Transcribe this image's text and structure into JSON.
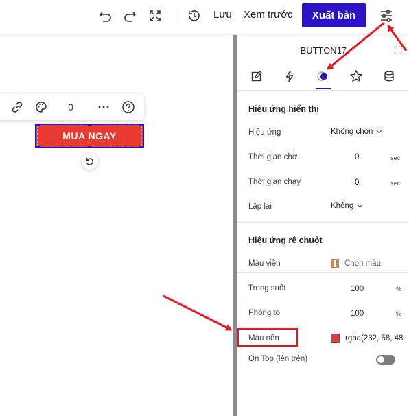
{
  "toolbar": {
    "undo_icon": "undo-icon",
    "redo_icon": "redo-icon",
    "fullscreen_icon": "fullscreen-icon",
    "history_icon": "history-icon",
    "save_label": "Lưu",
    "preview_label": "Xem trước",
    "publish_label": "Xuất bản",
    "settings_icon": "sliders-icon"
  },
  "canvas": {
    "floating_toolbar": {
      "link_icon": "link-icon",
      "palette_icon": "palette-icon",
      "count": "0",
      "more_icon": "more-icon",
      "help_icon": "help-icon"
    },
    "button_text": "MUA NGAY",
    "button_color": "#e83a30",
    "rotate_icon": "rotate-icon"
  },
  "panel": {
    "element_name": "BUTTON17",
    "tabs": [
      {
        "icon": "edit-icon"
      },
      {
        "icon": "lightning-icon"
      },
      {
        "icon": "effects-icon",
        "active": true
      },
      {
        "icon": "star-icon"
      },
      {
        "icon": "database-icon"
      }
    ],
    "display_effect": {
      "title": "Hiệu ứng hiển thị",
      "effect_label": "Hiệu ứng",
      "effect_value": "Không chọn",
      "delay_label": "Thời gian chờ",
      "delay_value": "0",
      "delay_unit": "sec",
      "duration_label": "Thời gian chạy",
      "duration_value": "0",
      "duration_unit": "sec",
      "repeat_label": "Lặp lại",
      "repeat_value": "Không"
    },
    "hover_effect": {
      "title": "Hiệu ứng rê chuột",
      "border_color_label": "Màu viền",
      "border_color_value": "Chọn màu",
      "opacity_label": "Trong suốt",
      "opacity_value": "100",
      "opacity_unit": "%",
      "zoom_label": "Phóng to",
      "zoom_value": "100",
      "zoom_unit": "%",
      "bg_color_label": "Màu nền",
      "bg_color_value": "rgba(232, 58, 48",
      "bg_color_hex": "#e83a30",
      "on_top_label": "On Top (lên trên)",
      "on_top_enabled": false
    }
  },
  "colors": {
    "accent": "#2a14c6",
    "annotation": "#e8161b"
  }
}
